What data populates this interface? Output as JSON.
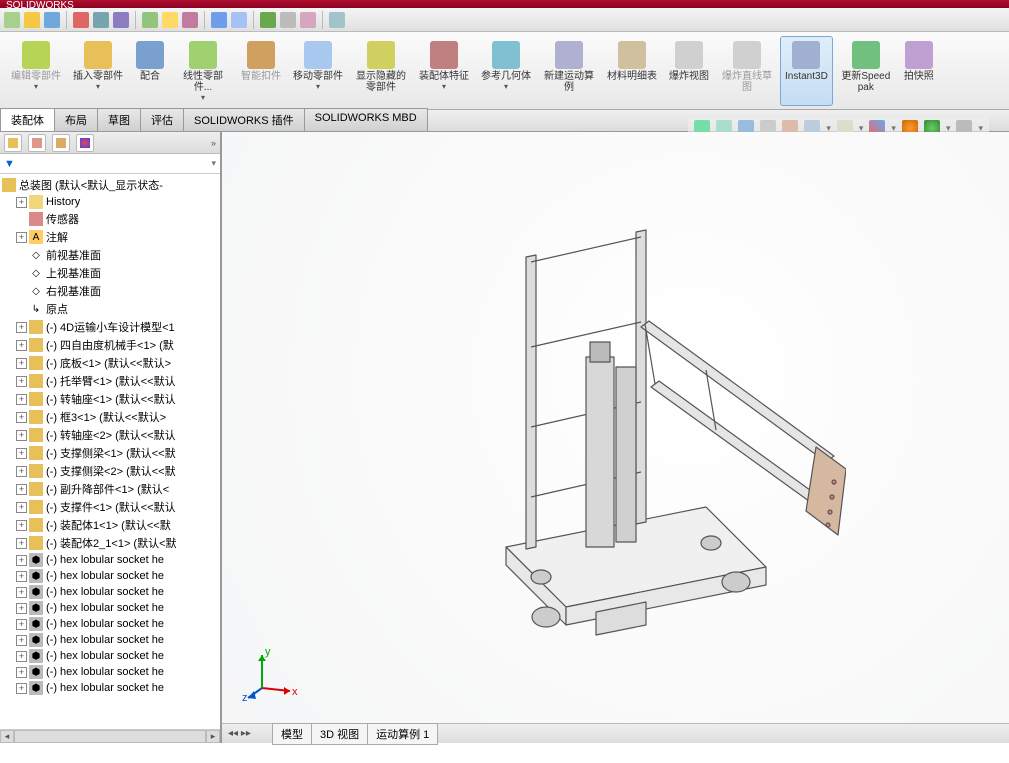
{
  "title": "SOLIDWORKS",
  "ribbon": [
    {
      "id": "edit-part",
      "label": "编辑零部件",
      "color": "#b7d457",
      "disabled": true,
      "arrow": true
    },
    {
      "id": "insert-part",
      "label": "插入零部件",
      "color": "#e8c05a",
      "arrow": true
    },
    {
      "id": "mate",
      "label": "配合",
      "color": "#7aa0d0",
      "arrow": false
    },
    {
      "id": "linear-pattern",
      "label": "线性零部件...",
      "color": "#a0d070",
      "arrow": true
    },
    {
      "id": "smart-fastener",
      "label": "智能扣件",
      "color": "#d0a060",
      "disabled": true
    },
    {
      "id": "move-part",
      "label": "移动零部件",
      "color": "#a8c8f0",
      "arrow": true
    },
    {
      "id": "show-hidden",
      "label": "显示隐藏的零部件",
      "color": "#d0d060"
    },
    {
      "id": "assembly-feat",
      "label": "装配体特征",
      "color": "#c08080",
      "arrow": true
    },
    {
      "id": "ref-geom",
      "label": "参考几何体",
      "color": "#80c0d0",
      "arrow": true
    },
    {
      "id": "new-motion",
      "label": "新建运动算例",
      "color": "#b0b0d0"
    },
    {
      "id": "bom",
      "label": "材料明细表",
      "color": "#d0c0a0"
    },
    {
      "id": "exploded",
      "label": "爆炸视图",
      "color": "#d0d0d0"
    },
    {
      "id": "exploded-line",
      "label": "爆炸直线草图",
      "color": "#d0d0d0",
      "disabled": true
    },
    {
      "id": "instant3d",
      "label": "Instant3D",
      "color": "#a0b0d0",
      "active": true
    },
    {
      "id": "update-speedpak",
      "label": "更新Speedpak",
      "color": "#70c080"
    },
    {
      "id": "snapshot",
      "label": "拍快照",
      "color": "#c0a0d0"
    }
  ],
  "tabs": [
    "装配体",
    "布局",
    "草图",
    "评估",
    "SOLIDWORKS 插件",
    "SOLIDWORKS MBD"
  ],
  "activeTab": 0,
  "filter_label": "▼",
  "tree_root": "总装图 (默认<默认_显示状态-",
  "tree": [
    {
      "depth": 1,
      "toggle": "+",
      "icon": "folder",
      "label": "History"
    },
    {
      "depth": 1,
      "toggle": "",
      "icon": "sensor",
      "label": "传感器"
    },
    {
      "depth": 1,
      "toggle": "+",
      "icon": "annot",
      "label": "注解"
    },
    {
      "depth": 1,
      "toggle": "",
      "icon": "plane",
      "label": "前视基准面"
    },
    {
      "depth": 1,
      "toggle": "",
      "icon": "plane",
      "label": "上视基准面"
    },
    {
      "depth": 1,
      "toggle": "",
      "icon": "plane",
      "label": "右视基准面"
    },
    {
      "depth": 1,
      "toggle": "",
      "icon": "origin",
      "label": "原点"
    },
    {
      "depth": 1,
      "toggle": "+",
      "icon": "asm",
      "label": "(-) 4D运输小车设计模型<1"
    },
    {
      "depth": 1,
      "toggle": "+",
      "icon": "asm",
      "label": "(-) 四自由度机械手<1> (默"
    },
    {
      "depth": 1,
      "toggle": "+",
      "icon": "asm",
      "label": "(-) 底板<1> (默认<<默认>"
    },
    {
      "depth": 1,
      "toggle": "+",
      "icon": "asm",
      "label": "(-) 托举臂<1> (默认<<默认"
    },
    {
      "depth": 1,
      "toggle": "+",
      "icon": "asm",
      "label": "(-) 转轴座<1> (默认<<默认"
    },
    {
      "depth": 1,
      "toggle": "+",
      "icon": "asm",
      "label": "(-) 框3<1> (默认<<默认>"
    },
    {
      "depth": 1,
      "toggle": "+",
      "icon": "asm",
      "label": "(-) 转轴座<2> (默认<<默认"
    },
    {
      "depth": 1,
      "toggle": "+",
      "icon": "asm",
      "label": "(-) 支撑侧梁<1> (默认<<默"
    },
    {
      "depth": 1,
      "toggle": "+",
      "icon": "asm",
      "label": "(-) 支撑侧梁<2> (默认<<默"
    },
    {
      "depth": 1,
      "toggle": "+",
      "icon": "asm",
      "label": "(-) 副升降部件<1> (默认<"
    },
    {
      "depth": 1,
      "toggle": "+",
      "icon": "asm",
      "label": "(-) 支撑件<1> (默认<<默认"
    },
    {
      "depth": 1,
      "toggle": "+",
      "icon": "asm",
      "label": "(-) 装配体1<1> (默认<<默"
    },
    {
      "depth": 1,
      "toggle": "+",
      "icon": "asm",
      "label": "(-) 装配体2_1<1> (默认<默"
    },
    {
      "depth": 1,
      "toggle": "+",
      "icon": "screw",
      "label": "(-) hex lobular socket he"
    },
    {
      "depth": 1,
      "toggle": "+",
      "icon": "screw",
      "label": "(-) hex lobular socket he"
    },
    {
      "depth": 1,
      "toggle": "+",
      "icon": "screw",
      "label": "(-) hex lobular socket he"
    },
    {
      "depth": 1,
      "toggle": "+",
      "icon": "screw",
      "label": "(-) hex lobular socket he"
    },
    {
      "depth": 1,
      "toggle": "+",
      "icon": "screw",
      "label": "(-) hex lobular socket he"
    },
    {
      "depth": 1,
      "toggle": "+",
      "icon": "screw",
      "label": "(-) hex lobular socket he"
    },
    {
      "depth": 1,
      "toggle": "+",
      "icon": "screw",
      "label": "(-) hex lobular socket he"
    },
    {
      "depth": 1,
      "toggle": "+",
      "icon": "screw",
      "label": "(-) hex lobular socket he"
    },
    {
      "depth": 1,
      "toggle": "+",
      "icon": "screw",
      "label": "(-) hex lobular socket he"
    }
  ],
  "bottom_tabs": [
    "模型",
    "3D 视图",
    "运动算例 1"
  ],
  "triad": {
    "x": "x",
    "y": "y",
    "z": "z"
  }
}
